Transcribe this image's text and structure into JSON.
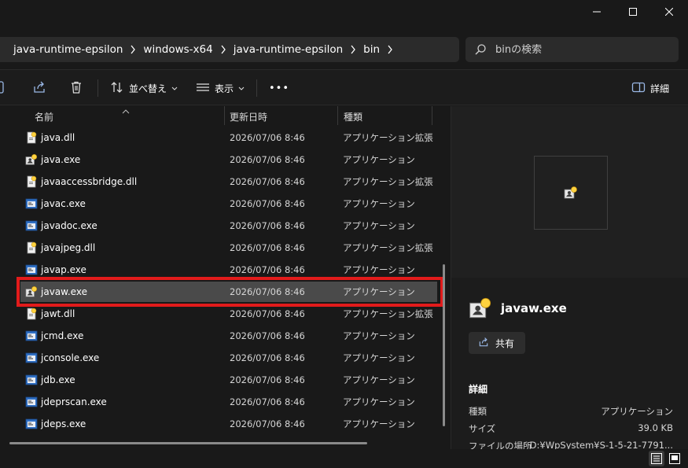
{
  "window": {
    "controls": [
      "minimize",
      "maximize",
      "close"
    ]
  },
  "breadcrumb": {
    "items": [
      "java-runtime-epsilon",
      "windows-x64",
      "java-runtime-epsilon",
      "bin"
    ]
  },
  "search": {
    "placeholder": "binの検索"
  },
  "toolbar": {
    "sort_label": "並べ替え",
    "view_label": "表示",
    "more_label": "•••",
    "details_label": "詳細"
  },
  "columns": {
    "name": "名前",
    "date": "更新日時",
    "type": "種類"
  },
  "files": [
    {
      "name": "java.dll",
      "date": "2026/07/06 8:46",
      "type": "アプリケーション拡張",
      "icon": "dll-icon"
    },
    {
      "name": "java.exe",
      "date": "2026/07/06 8:46",
      "type": "アプリケーション",
      "icon": "java-exe-icon"
    },
    {
      "name": "javaaccessbridge.dll",
      "date": "2026/07/06 8:46",
      "type": "アプリケーション拡張",
      "icon": "dll-icon"
    },
    {
      "name": "javac.exe",
      "date": "2026/07/06 8:46",
      "type": "アプリケーション",
      "icon": "exe-icon"
    },
    {
      "name": "javadoc.exe",
      "date": "2026/07/06 8:46",
      "type": "アプリケーション",
      "icon": "exe-icon"
    },
    {
      "name": "javajpeg.dll",
      "date": "2026/07/06 8:46",
      "type": "アプリケーション拡張",
      "icon": "dll-icon"
    },
    {
      "name": "javap.exe",
      "date": "2026/07/06 8:46",
      "type": "アプリケーション",
      "icon": "exe-icon"
    },
    {
      "name": "javaw.exe",
      "date": "2026/07/06 8:46",
      "type": "アプリケーション",
      "icon": "java-exe-icon",
      "selected": true
    },
    {
      "name": "jawt.dll",
      "date": "2026/07/06 8:46",
      "type": "アプリケーション拡張",
      "icon": "dll-icon"
    },
    {
      "name": "jcmd.exe",
      "date": "2026/07/06 8:46",
      "type": "アプリケーション",
      "icon": "exe-icon"
    },
    {
      "name": "jconsole.exe",
      "date": "2026/07/06 8:46",
      "type": "アプリケーション",
      "icon": "exe-icon"
    },
    {
      "name": "jdb.exe",
      "date": "2026/07/06 8:46",
      "type": "アプリケーション",
      "icon": "exe-icon"
    },
    {
      "name": "jdeprscan.exe",
      "date": "2026/07/06 8:46",
      "type": "アプリケーション",
      "icon": "exe-icon"
    },
    {
      "name": "jdeps.exe",
      "date": "2026/07/06 8:46",
      "type": "アプリケーション",
      "icon": "exe-icon"
    }
  ],
  "details": {
    "file_name": "javaw.exe",
    "share_label": "共有",
    "section_title": "詳細",
    "props": [
      {
        "label": "種類",
        "value": "アプリケーション"
      },
      {
        "label": "サイズ",
        "value": "39.0 KB"
      },
      {
        "label": "ファイルの場所",
        "value": "D:¥WpSystem¥S-1-5-21-7791..."
      }
    ]
  },
  "colors": {
    "background": "#191919",
    "selection": "#4a4a4a",
    "highlight_border": "#e21b1b",
    "panel": "#202020"
  }
}
